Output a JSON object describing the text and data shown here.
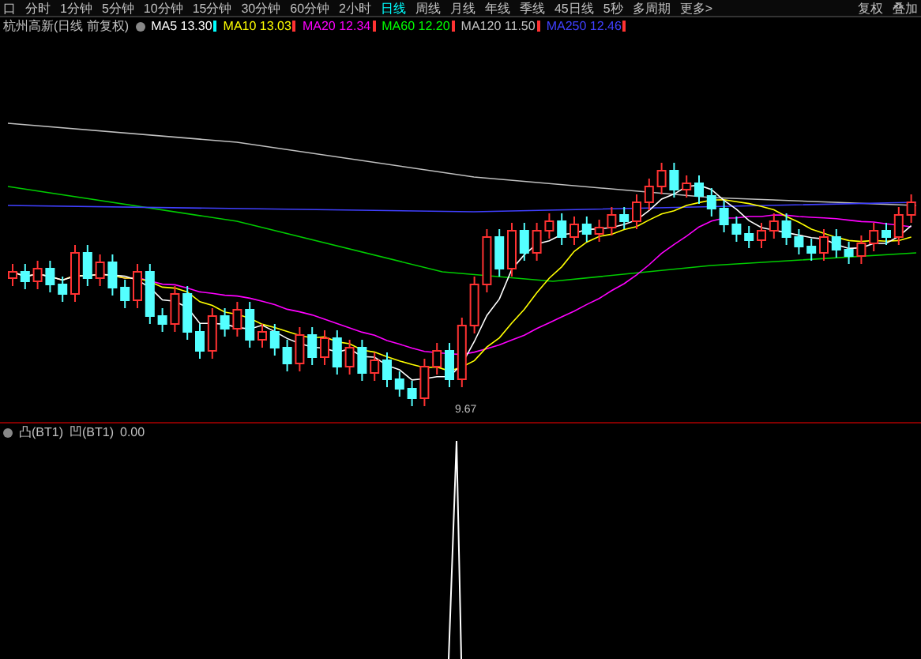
{
  "period_tabs": [
    {
      "label": "口",
      "selected": false
    },
    {
      "label": "分时",
      "selected": false
    },
    {
      "label": "1分钟",
      "selected": false
    },
    {
      "label": "5分钟",
      "selected": false
    },
    {
      "label": "10分钟",
      "selected": false
    },
    {
      "label": "15分钟",
      "selected": false
    },
    {
      "label": "30分钟",
      "selected": false
    },
    {
      "label": "60分钟",
      "selected": false
    },
    {
      "label": "2小时",
      "selected": false
    },
    {
      "label": "日线",
      "selected": true
    },
    {
      "label": "周线",
      "selected": false
    },
    {
      "label": "月线",
      "selected": false
    },
    {
      "label": "年线",
      "selected": false
    },
    {
      "label": "季线",
      "selected": false
    },
    {
      "label": "45日线",
      "selected": false
    },
    {
      "label": "5秒",
      "selected": false
    },
    {
      "label": "多周期",
      "selected": false
    },
    {
      "label": "更多>",
      "selected": false
    }
  ],
  "toolbar_right": [
    "复权",
    "叠加"
  ],
  "chart_header": {
    "title": "杭州高新(日线 前复权)",
    "averages": [
      {
        "name": "MA5",
        "value": "13.30",
        "rising": false,
        "color": "#ffffff"
      },
      {
        "name": "MA10",
        "value": "13.03",
        "rising": true,
        "color": "#ffff00"
      },
      {
        "name": "MA20",
        "value": "12.34",
        "rising": true,
        "color": "#ff00ff"
      },
      {
        "name": "MA60",
        "value": "12.20",
        "rising": true,
        "color": "#00ff00"
      },
      {
        "name": "MA120",
        "value": "11.50",
        "rising": true,
        "color": "#c0c0c0"
      },
      {
        "name": "MA250",
        "value": "12.46",
        "rising": true,
        "color": "#4040ff"
      }
    ]
  },
  "low_label": "9.67",
  "indicator_header": {
    "title": "凸(BT1)",
    "series": "凹(BT1)",
    "value": "0.00"
  }
}
